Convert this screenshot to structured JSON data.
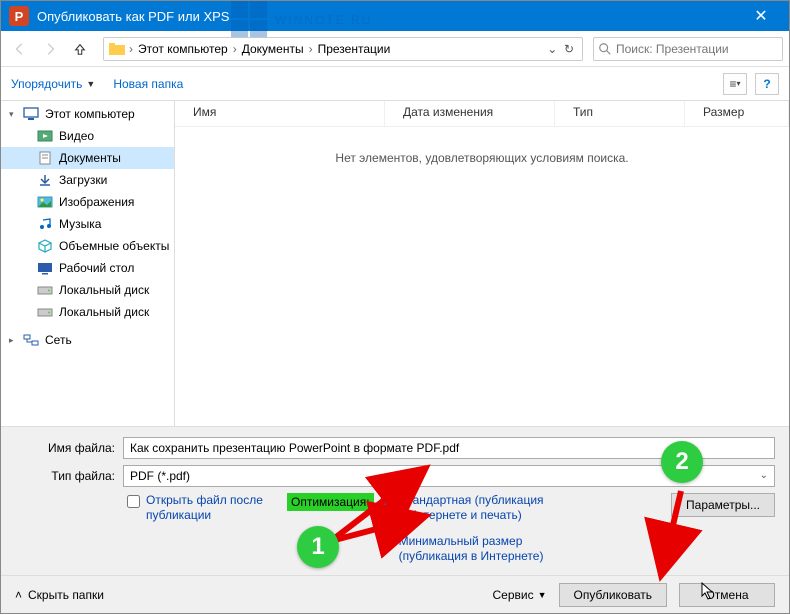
{
  "title": "Опубликовать как PDF или XPS",
  "watermark": "WINNOTE.RU",
  "breadcrumbs": [
    "Этот компьютер",
    "Документы",
    "Презентации"
  ],
  "search": {
    "placeholder": "Поиск: Презентации"
  },
  "toolbar": {
    "organize": "Упорядочить",
    "newfolder": "Новая папка"
  },
  "columns": {
    "name": "Имя",
    "date": "Дата изменения",
    "type": "Тип",
    "size": "Размер"
  },
  "empty": "Нет элементов, удовлетворяющих условиям поиска.",
  "sidebar": {
    "root": "Этот компьютер",
    "items": [
      {
        "label": "Видео",
        "icon": "video"
      },
      {
        "label": "Документы",
        "icon": "doc",
        "selected": true
      },
      {
        "label": "Загрузки",
        "icon": "down"
      },
      {
        "label": "Изображения",
        "icon": "img"
      },
      {
        "label": "Музыка",
        "icon": "music"
      },
      {
        "label": "Объемные объекты",
        "icon": "cube"
      },
      {
        "label": "Рабочий стол",
        "icon": "desk"
      },
      {
        "label": "Локальный диск",
        "icon": "drive"
      },
      {
        "label": "Локальный диск",
        "icon": "drive"
      }
    ],
    "network": "Сеть"
  },
  "fields": {
    "filename_lbl": "Имя файла:",
    "filetype_lbl": "Тип файла:",
    "filename": "Как сохранить презентацию PowerPoint в формате PDF.pdf",
    "filetype": "PDF (*.pdf)"
  },
  "open_after": "Открыть файл после публикации",
  "optimize_label": "Оптимизация:",
  "opt1": "Стандартная (публикация в Интернете и печать)",
  "opt2": "Минимальный размер (публикация в Интернете)",
  "params": "Параметры...",
  "service": "Сервис",
  "publish": "Опубликовать",
  "cancel": "Отмена",
  "hide_folders": "Скрыть папки",
  "annot": {
    "n1": "1",
    "n2": "2"
  }
}
